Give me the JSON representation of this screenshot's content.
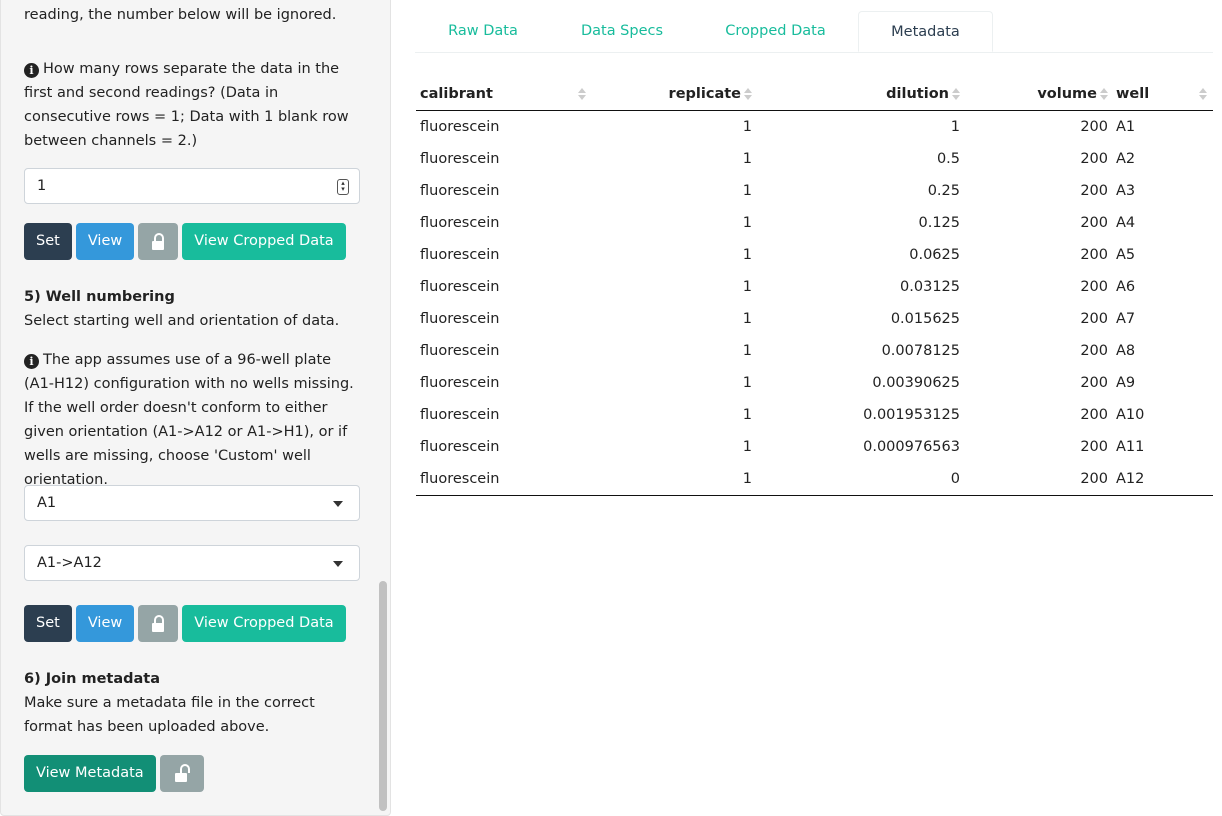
{
  "sidebar": {
    "reading_note": "reading, the number below will be ignored.",
    "rows_question": "How many rows separate the data in the first and second readings? (Data in consecutive rows = 1; Data with 1 blank row between channels = 2.)",
    "rows_value": "1",
    "buttons": {
      "set": "Set",
      "view": "View",
      "view_cropped": "View Cropped Data"
    },
    "well_heading": "5) Well numbering",
    "well_desc": "Select starting well and orientation of data.",
    "well_info": "The app assumes use of a 96-well plate (A1-H12) configuration with no wells missing. If the well order doesn't conform to either given orientation (A1->A12 or A1->H1), or if wells are missing, choose 'Custom' well orientation.",
    "start_well": "A1",
    "orientation": "A1->A12",
    "meta_heading": "6) Join metadata",
    "meta_desc": "Make sure a metadata file in the correct format has been uploaded above.",
    "view_metadata": "View Metadata"
  },
  "tabs": [
    {
      "label": "Raw Data"
    },
    {
      "label": "Data Specs"
    },
    {
      "label": "Cropped Data"
    },
    {
      "label": "Metadata"
    }
  ],
  "active_tab": "Metadata",
  "table": {
    "columns": [
      "calibrant",
      "replicate",
      "dilution",
      "volume",
      "well"
    ],
    "rows": [
      [
        "fluorescein",
        "1",
        "1",
        "200",
        "A1"
      ],
      [
        "fluorescein",
        "1",
        "0.5",
        "200",
        "A2"
      ],
      [
        "fluorescein",
        "1",
        "0.25",
        "200",
        "A3"
      ],
      [
        "fluorescein",
        "1",
        "0.125",
        "200",
        "A4"
      ],
      [
        "fluorescein",
        "1",
        "0.0625",
        "200",
        "A5"
      ],
      [
        "fluorescein",
        "1",
        "0.03125",
        "200",
        "A6"
      ],
      [
        "fluorescein",
        "1",
        "0.015625",
        "200",
        "A7"
      ],
      [
        "fluorescein",
        "1",
        "0.0078125",
        "200",
        "A8"
      ],
      [
        "fluorescein",
        "1",
        "0.00390625",
        "200",
        "A9"
      ],
      [
        "fluorescein",
        "1",
        "0.001953125",
        "200",
        "A10"
      ],
      [
        "fluorescein",
        "1",
        "0.000976563",
        "200",
        "A11"
      ],
      [
        "fluorescein",
        "1",
        "0",
        "200",
        "A12"
      ]
    ]
  }
}
